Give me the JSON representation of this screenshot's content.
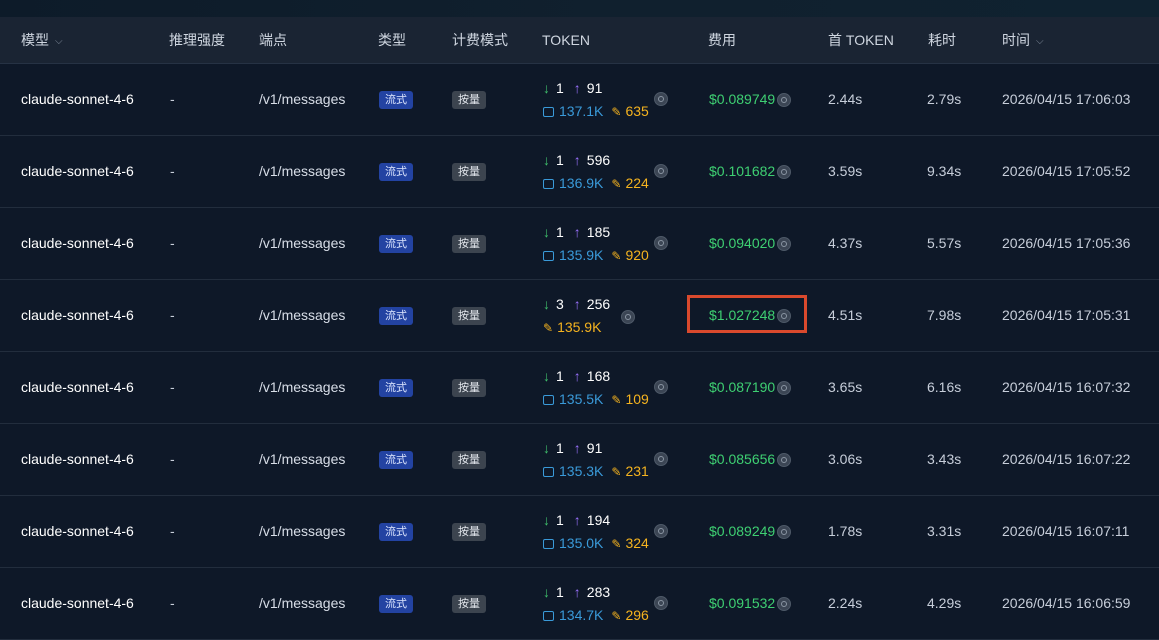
{
  "headers": {
    "model": "模型",
    "reasoning": "推理强度",
    "endpoint": "端点",
    "type": "类型",
    "billing": "计费模式",
    "token": "TOKEN",
    "cost": "费用",
    "first_token": "首 TOKEN",
    "duration": "耗时",
    "time": "时间"
  },
  "colors": {
    "stream_tag": "#2343a2",
    "bill_tag": "#3c444f",
    "cost_green": "#3ecf72",
    "cache_blue": "#3a9ad9",
    "write_orange": "#f5b31f",
    "highlight_red": "#d9492d"
  },
  "rows": [
    {
      "model": "claude-sonnet-4-6",
      "reasoning": "-",
      "endpoint": "/v1/messages",
      "type": "流式",
      "billing": "按量",
      "tok_in": "1",
      "tok_out": "91",
      "cache": "137.1K",
      "write": "635",
      "cost": "$0.089749",
      "first": "2.44s",
      "dur": "2.79s",
      "time": "2026/04/15 17:06:03"
    },
    {
      "model": "claude-sonnet-4-6",
      "reasoning": "-",
      "endpoint": "/v1/messages",
      "type": "流式",
      "billing": "按量",
      "tok_in": "1",
      "tok_out": "596",
      "cache": "136.9K",
      "write": "224",
      "cost": "$0.101682",
      "first": "3.59s",
      "dur": "9.34s",
      "time": "2026/04/15 17:05:52"
    },
    {
      "model": "claude-sonnet-4-6",
      "reasoning": "-",
      "endpoint": "/v1/messages",
      "type": "流式",
      "billing": "按量",
      "tok_in": "1",
      "tok_out": "185",
      "cache": "135.9K",
      "write": "920",
      "cost": "$0.094020",
      "first": "4.37s",
      "dur": "5.57s",
      "time": "2026/04/15 17:05:36"
    },
    {
      "model": "claude-sonnet-4-6",
      "reasoning": "-",
      "endpoint": "/v1/messages",
      "type": "流式",
      "billing": "按量",
      "tok_in": "3",
      "tok_out": "256",
      "cache": "",
      "write": "135.9K",
      "cost": "$1.027248",
      "first": "4.51s",
      "dur": "7.98s",
      "time": "2026/04/15 17:05:31",
      "highlighted": true
    },
    {
      "model": "claude-sonnet-4-6",
      "reasoning": "-",
      "endpoint": "/v1/messages",
      "type": "流式",
      "billing": "按量",
      "tok_in": "1",
      "tok_out": "168",
      "cache": "135.5K",
      "write": "109",
      "cost": "$0.087190",
      "first": "3.65s",
      "dur": "6.16s",
      "time": "2026/04/15 16:07:32"
    },
    {
      "model": "claude-sonnet-4-6",
      "reasoning": "-",
      "endpoint": "/v1/messages",
      "type": "流式",
      "billing": "按量",
      "tok_in": "1",
      "tok_out": "91",
      "cache": "135.3K",
      "write": "231",
      "cost": "$0.085656",
      "first": "3.06s",
      "dur": "3.43s",
      "time": "2026/04/15 16:07:22"
    },
    {
      "model": "claude-sonnet-4-6",
      "reasoning": "-",
      "endpoint": "/v1/messages",
      "type": "流式",
      "billing": "按量",
      "tok_in": "1",
      "tok_out": "194",
      "cache": "135.0K",
      "write": "324",
      "cost": "$0.089249",
      "first": "1.78s",
      "dur": "3.31s",
      "time": "2026/04/15 16:07:11"
    },
    {
      "model": "claude-sonnet-4-6",
      "reasoning": "-",
      "endpoint": "/v1/messages",
      "type": "流式",
      "billing": "按量",
      "tok_in": "1",
      "tok_out": "283",
      "cache": "134.7K",
      "write": "296",
      "cost": "$0.091532",
      "first": "2.24s",
      "dur": "4.29s",
      "time": "2026/04/15 16:06:59"
    }
  ]
}
